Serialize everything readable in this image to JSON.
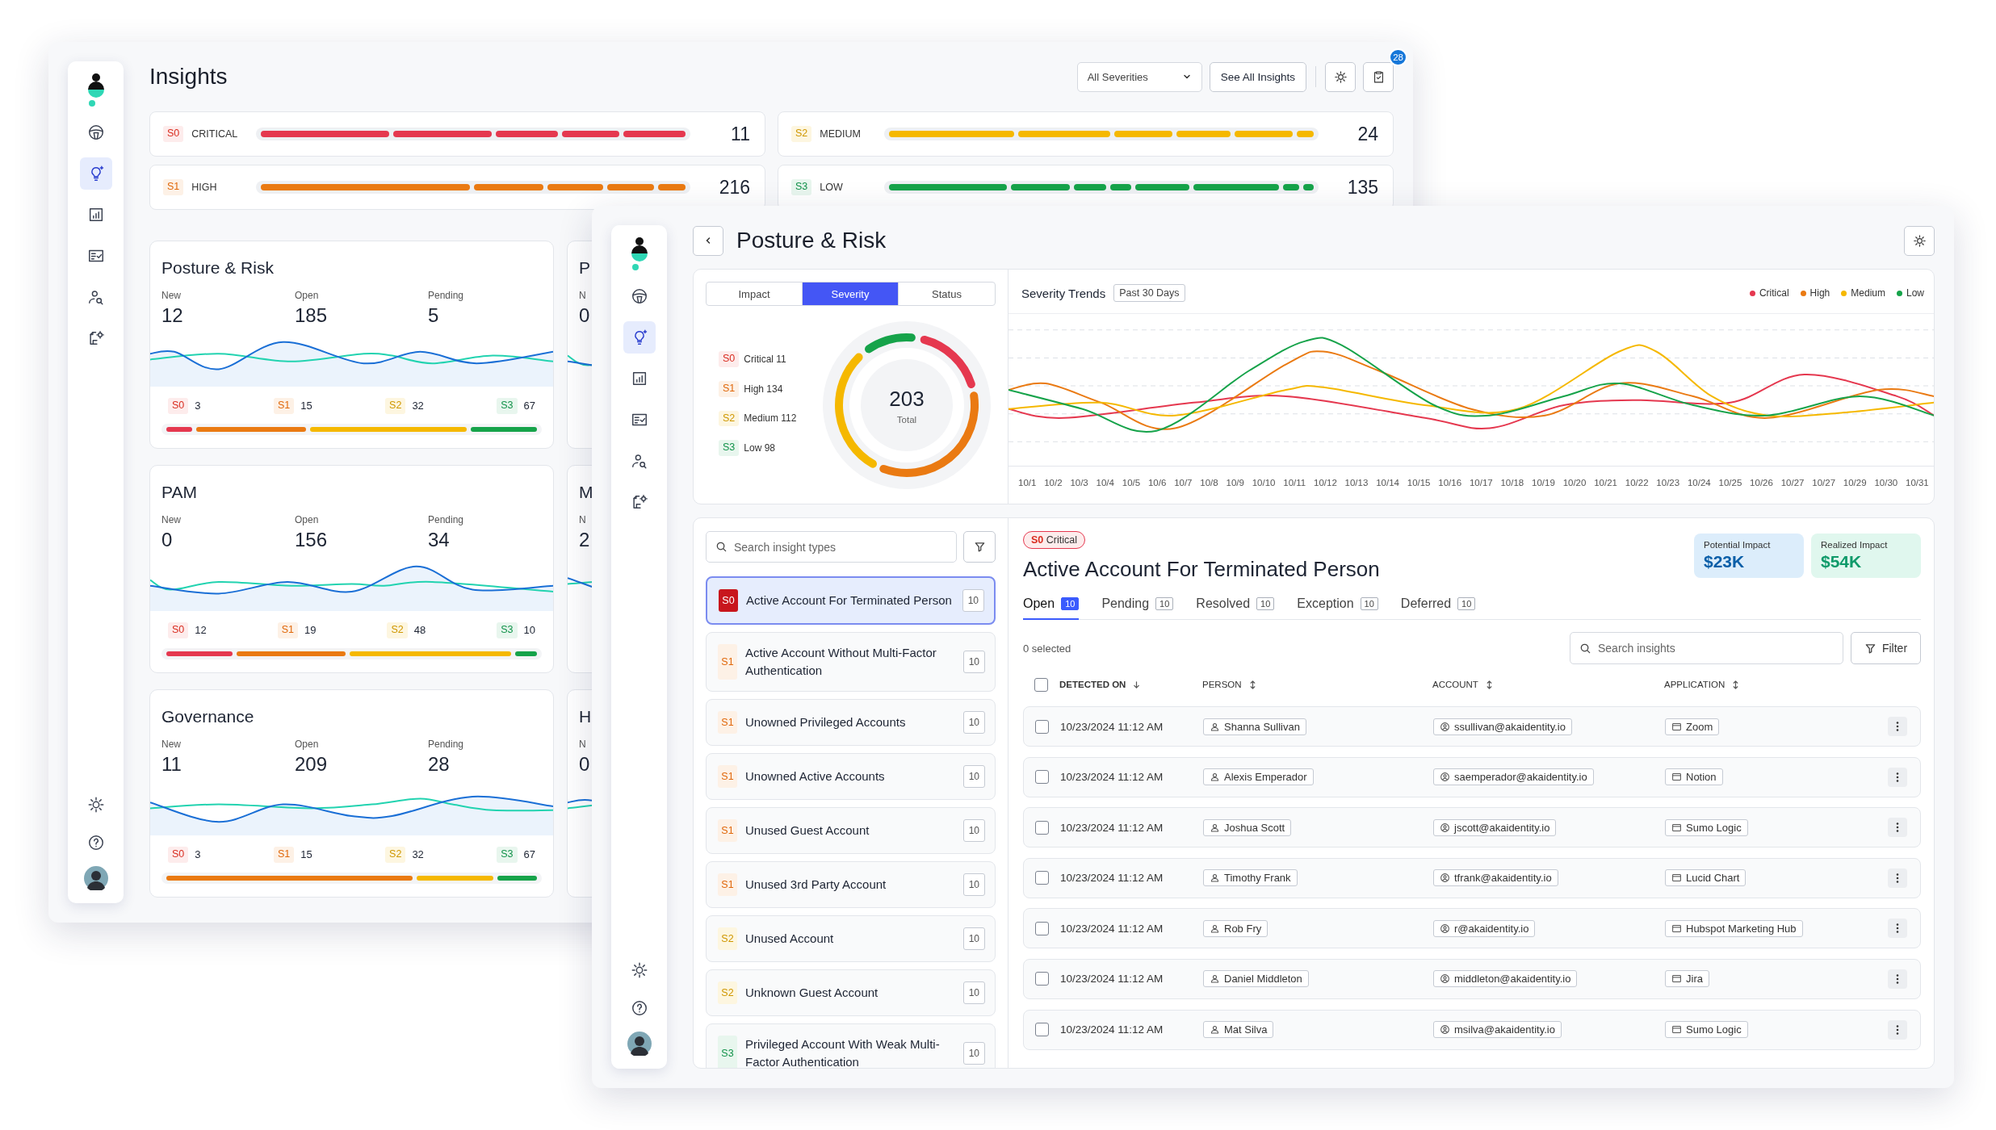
{
  "back_window": {
    "title": "Insights",
    "sidebar": {
      "items": [
        {
          "selected": false
        },
        {
          "selected": true
        },
        {
          "selected": false
        },
        {
          "selected": false
        },
        {
          "selected": false
        },
        {
          "selected": false
        }
      ]
    },
    "severity_filter": {
      "value": "All Severities"
    },
    "see_all_button": "See All Insights",
    "notification_count": "28",
    "severity_rows": [
      {
        "code": "S0",
        "label": "CRITICAL",
        "kind": "critical",
        "count": "11"
      },
      {
        "code": "S2",
        "label": "MEDIUM",
        "kind": "medium",
        "count": "24"
      },
      {
        "code": "S1",
        "label": "HIGH",
        "kind": "high",
        "count": "216"
      },
      {
        "code": "S3",
        "label": "LOW",
        "kind": "low",
        "count": "135"
      }
    ],
    "cards": [
      {
        "title": "Posture & Risk",
        "stats": [
          {
            "label": "New",
            "value": "12"
          },
          {
            "label": "Open",
            "value": "185"
          },
          {
            "label": "Pending",
            "value": "5"
          }
        ],
        "severities": [
          {
            "code": "S0",
            "kind": "critical",
            "count": "3"
          },
          {
            "code": "S1",
            "kind": "high",
            "count": "15"
          },
          {
            "code": "S2",
            "kind": "medium",
            "count": "32"
          },
          {
            "code": "S3",
            "kind": "low",
            "count": "67"
          }
        ]
      },
      {
        "title": "PAM",
        "stats": [
          {
            "label": "New",
            "value": "0"
          },
          {
            "label": "Open",
            "value": "156"
          },
          {
            "label": "Pending",
            "value": "34"
          }
        ],
        "severities": [
          {
            "code": "S0",
            "kind": "critical",
            "count": "12"
          },
          {
            "code": "S1",
            "kind": "high",
            "count": "19"
          },
          {
            "code": "S2",
            "kind": "medium",
            "count": "48"
          },
          {
            "code": "S3",
            "kind": "low",
            "count": "10"
          }
        ]
      },
      {
        "title": "Governance",
        "stats": [
          {
            "label": "New",
            "value": "11"
          },
          {
            "label": "Open",
            "value": "209"
          },
          {
            "label": "Pending",
            "value": "28"
          }
        ],
        "severities": [
          {
            "code": "S0",
            "kind": "critical",
            "count": "3"
          },
          {
            "code": "S1",
            "kind": "high",
            "count": "15"
          },
          {
            "code": "S2",
            "kind": "medium",
            "count": "32"
          },
          {
            "code": "S3",
            "kind": "low",
            "count": "67"
          }
        ]
      }
    ],
    "cut_cards": [
      {
        "title": "P",
        "stat_label": "N",
        "stat_value": "0"
      },
      {
        "title": "M",
        "stat_label": "N",
        "stat_value": "2"
      },
      {
        "title": "H",
        "stat_label": "N",
        "stat_value": "0"
      }
    ]
  },
  "front_window": {
    "title": "Posture & Risk",
    "sidebar": {
      "items": [
        {
          "selected": false
        },
        {
          "selected": true
        },
        {
          "selected": false
        },
        {
          "selected": false
        },
        {
          "selected": false
        },
        {
          "selected": false
        }
      ]
    },
    "summary": {
      "tabs": [
        {
          "label": "Impact",
          "selected": false
        },
        {
          "label": "Severity",
          "selected": true
        },
        {
          "label": "Status",
          "selected": false
        }
      ],
      "legend": [
        {
          "code": "S0",
          "kind": "critical",
          "label": "Critical 11"
        },
        {
          "code": "S1",
          "kind": "high",
          "label": "High 134"
        },
        {
          "code": "S2",
          "kind": "medium",
          "label": "Medium 112"
        },
        {
          "code": "S3",
          "kind": "low",
          "label": "Low 98"
        }
      ],
      "total": "203",
      "total_label": "Total"
    },
    "trends": {
      "title": "Severity Trends",
      "range": "Past 30 Days",
      "legend": [
        {
          "label": "Critical",
          "color": "#e5384f"
        },
        {
          "label": "High",
          "color": "#ea7a12"
        },
        {
          "label": "Medium",
          "color": "#f5b800"
        },
        {
          "label": "Low",
          "color": "#16a34a"
        }
      ],
      "dates": [
        "10/1",
        "10/2",
        "10/3",
        "10/4",
        "10/5",
        "10/6",
        "10/7",
        "10/8",
        "10/9",
        "10/10",
        "10/11",
        "10/12",
        "10/13",
        "10/14",
        "10/15",
        "10/16",
        "10/17",
        "10/18",
        "10/19",
        "10/20",
        "10/21",
        "10/22",
        "10/23",
        "10/24",
        "10/25",
        "10/26",
        "10/27",
        "10/27",
        "10/29",
        "10/30",
        "10/31"
      ]
    },
    "insight_search": {
      "placeholder": "Search insight types"
    },
    "insight_types": [
      {
        "code": "S0",
        "kind": "critical",
        "title": "Active Account For Terminated Person",
        "count": "10",
        "selected": true
      },
      {
        "code": "S1",
        "kind": "high",
        "title": "Active Account Without Multi-Factor Authentication",
        "count": "10",
        "selected": false
      },
      {
        "code": "S1",
        "kind": "high",
        "title": "Unowned Privileged Accounts",
        "count": "10",
        "selected": false
      },
      {
        "code": "S1",
        "kind": "high",
        "title": "Unowned Active Accounts",
        "count": "10",
        "selected": false
      },
      {
        "code": "S1",
        "kind": "high",
        "title": "Unused Guest Account",
        "count": "10",
        "selected": false
      },
      {
        "code": "S1",
        "kind": "high",
        "title": "Unused 3rd Party Account",
        "count": "10",
        "selected": false
      },
      {
        "code": "S2",
        "kind": "medium",
        "title": "Unused Account",
        "count": "10",
        "selected": false
      },
      {
        "code": "S2",
        "kind": "medium",
        "title": "Unknown Guest Account",
        "count": "10",
        "selected": false
      },
      {
        "code": "S3",
        "kind": "low",
        "title": "Privileged Account With Weak Multi-Factor Authentication",
        "count": "10",
        "selected": false
      }
    ],
    "detail": {
      "severity": {
        "code": "S0",
        "label": "Critical",
        "kind": "critical"
      },
      "title": "Active Account For Terminated Person",
      "impacts": [
        {
          "label": "Potential Impact",
          "value": "$23K",
          "kind": "potential"
        },
        {
          "label": "Realized Impact",
          "value": "$54K",
          "kind": "realized"
        }
      ],
      "tabs": [
        {
          "label": "Open",
          "count": "10",
          "selected": true
        },
        {
          "label": "Pending",
          "count": "10",
          "selected": false
        },
        {
          "label": "Resolved",
          "count": "10",
          "selected": false
        },
        {
          "label": "Exception",
          "count": "10",
          "selected": false
        },
        {
          "label": "Deferred",
          "count": "10",
          "selected": false
        }
      ],
      "selection_count": "0 selected",
      "search": {
        "placeholder": "Search insights"
      },
      "filter_button": "Filter",
      "all_checked": false,
      "columns": [
        {
          "label": "DETECTED ON",
          "sorted": true
        },
        {
          "label": "PERSON",
          "sorted": false
        },
        {
          "label": "ACCOUNT",
          "sorted": false
        },
        {
          "label": "APPLICATION",
          "sorted": false
        }
      ],
      "rows": [
        {
          "checked": false,
          "detected_on": "10/23/2024 11:12 AM",
          "person": "Shanna Sullivan",
          "account": "ssullivan@akaidentity.io",
          "application": "Zoom"
        },
        {
          "checked": false,
          "detected_on": "10/23/2024 11:12 AM",
          "person": "Alexis Emperador",
          "account": "saemperador@akaidentity.io",
          "application": "Notion"
        },
        {
          "checked": false,
          "detected_on": "10/23/2024 11:12 AM",
          "person": "Joshua Scott",
          "account": "jscott@akaidentity.io",
          "application": "Sumo Logic"
        },
        {
          "checked": false,
          "detected_on": "10/23/2024 11:12 AM",
          "person": "Timothy Frank",
          "account": "tfrank@akaidentity.io",
          "application": "Lucid Chart"
        },
        {
          "checked": false,
          "detected_on": "10/23/2024 11:12 AM",
          "person": "Rob Fry",
          "account": "r@akaidentity.io",
          "application": "Hubspot Marketing Hub"
        },
        {
          "checked": false,
          "detected_on": "10/23/2024 11:12 AM",
          "person": "Daniel Middleton",
          "account": "middleton@akaidentity.io",
          "application": "Jira"
        },
        {
          "checked": false,
          "detected_on": "10/23/2024 11:12 AM",
          "person": "Mat Silva",
          "account": "msilva@akaidentity.io",
          "application": "Sumo Logic"
        }
      ]
    }
  }
}
